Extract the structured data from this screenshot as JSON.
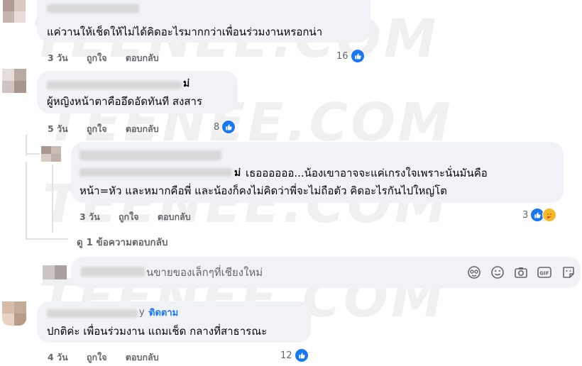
{
  "watermark": "TEENEE.COM",
  "comments": [
    {
      "text": "แค่วานให้เช็ดให้ไม่ได้คิดอะไรมากกว่าเพื่อนร่วมงานหรอกน่า",
      "time": "3 วัน",
      "like": "ถูกใจ",
      "reply": "ตอบกลับ",
      "reactions": "16"
    },
    {
      "name_tail": "ม่",
      "text": "ผู้หญิงหน้าตาคืออึดอัดทันที สงสาร",
      "time": "5 วัน",
      "like": "ถูกใจ",
      "reply": "ตอบกลับ",
      "reactions": "8"
    },
    {
      "name_tail": "ม่",
      "line1": "เธออออออ...น้องเขาอาจจะแค่เกรงใจเพราะนั่นมันคือ",
      "line2": "หน้า=หัว และหมากคือพี่ และน้องก็คงไม่คิดว่าพี่จะไม่ถือตัว คิดอะไรกันไปใหญ่โต",
      "time": "3 วัน",
      "like": "ถูกใจ",
      "reply": "ตอบกลับ",
      "reactions": "3"
    },
    {
      "follow": "ติดตาม",
      "text": "ปกติค่ะ เพื่อนร่วมงาน แถมเช็ด กลางที่สาธารณะ",
      "time": "4 วัน",
      "like": "ถูกใจ",
      "reply": "ตอบกลับ",
      "reactions": "12"
    }
  ],
  "view_replies": "ดู 1 ข้อความตอบกลับ",
  "composer": {
    "placeholder_tail": "นขายของเล็กๆที่เชียงใหม่"
  },
  "icons": {
    "like_badge": "thumbs-up-icon",
    "care_badge": "care-emoji-icon",
    "composer": [
      "avatar-sticker-icon",
      "smiley-icon",
      "camera-icon",
      "gif-icon",
      "sticker-icon"
    ]
  },
  "colors": {
    "bubble": "#f0f2f5",
    "meta": "#65676b",
    "accent": "#1877f2"
  }
}
